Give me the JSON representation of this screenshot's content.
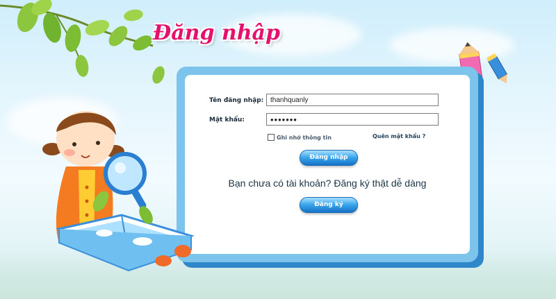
{
  "page_title": "Đăng nhập",
  "form": {
    "username_label": "Tên đăng nhập:",
    "username_value": "thanhquanly",
    "password_label": "Mật khẩu:",
    "password_value": "•••••••",
    "remember_label": "Ghi nhớ thông tin",
    "forgot_label": "Quên mật khẩu ?",
    "login_button": "Đăng nhập"
  },
  "signup": {
    "prompt": "Bạn chưa có tài khoản? Đăng ký thật dễ dàng",
    "button": "Đăng ký"
  },
  "colors": {
    "title": "#e2126d",
    "panel_border": "#7cc4ec",
    "button": "#1e88d8"
  },
  "decorations": [
    "leaf-branch",
    "pencil-icon",
    "girl-reading-illustration"
  ]
}
